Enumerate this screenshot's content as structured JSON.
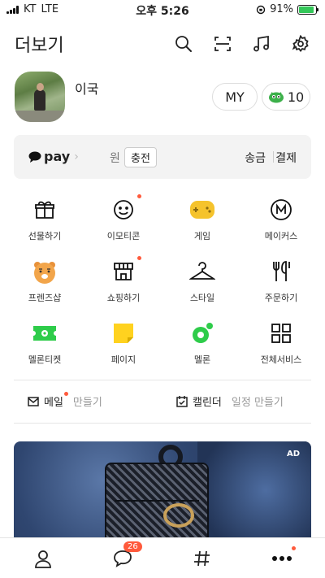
{
  "status_bar": {
    "carrier": "KT",
    "network": "LTE",
    "time": "오후 5:26",
    "battery": "91%",
    "battery_level": 0.91
  },
  "header": {
    "title": "더보기",
    "icons": [
      "search-icon",
      "scan-icon",
      "music-icon",
      "settings-icon"
    ]
  },
  "profile": {
    "name": "이국",
    "my_label": "MY",
    "coin_count": "10"
  },
  "pay": {
    "logo": "pay",
    "currency": "원",
    "charge_label": "충전",
    "send_label": "송금",
    "pay_label": "결제"
  },
  "grid": [
    {
      "label": "선물하기",
      "icon": "gift-icon",
      "new": false
    },
    {
      "label": "이모티콘",
      "icon": "emoticon-icon",
      "new": true
    },
    {
      "label": "게임",
      "icon": "gamepad-icon",
      "new": false
    },
    {
      "label": "메이커스",
      "icon": "makers-icon",
      "new": false
    },
    {
      "label": "프렌즈샵",
      "icon": "friends-shop-icon",
      "new": false
    },
    {
      "label": "쇼핑하기",
      "icon": "shop-icon",
      "new": true
    },
    {
      "label": "스타일",
      "icon": "hanger-icon",
      "new": false
    },
    {
      "label": "주문하기",
      "icon": "fork-knife-icon",
      "new": false
    },
    {
      "label": "멜론티켓",
      "icon": "ticket-icon",
      "new": false
    },
    {
      "label": "페이지",
      "icon": "page-icon",
      "new": false
    },
    {
      "label": "멜론",
      "icon": "melon-icon",
      "new": false
    },
    {
      "label": "전체서비스",
      "icon": "all-services-icon",
      "new": false
    }
  ],
  "links": {
    "mail_label": "메일",
    "mail_action": "만들기",
    "calendar_label": "캘린더",
    "calendar_action": "일정 만들기"
  },
  "ad": {
    "label": "AD"
  },
  "tabbar": {
    "chat_badge": "26",
    "tabs": [
      "friends-tab",
      "chats-tab",
      "view-tab",
      "more-tab"
    ]
  },
  "colors": {
    "accent_dot": "#ff5a3c",
    "pay_bg": "#f3f3f3",
    "game_yellow": "#f5c32c",
    "melon_green": "#2ecc4a",
    "page_yellow": "#ffd21f"
  }
}
